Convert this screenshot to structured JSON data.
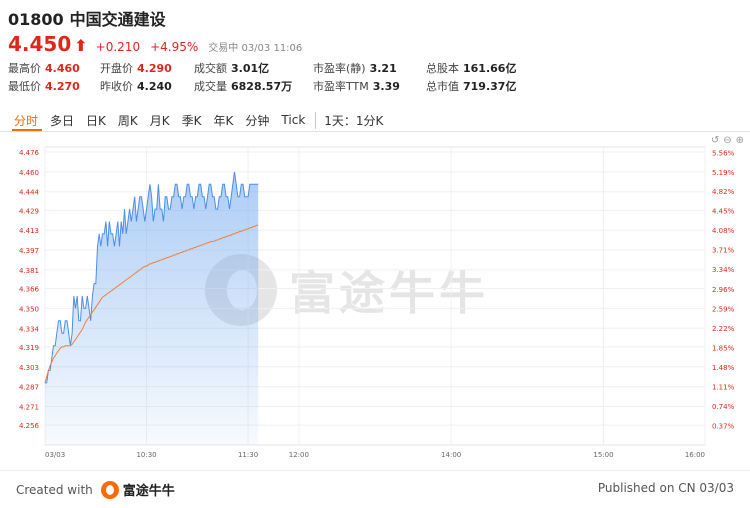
{
  "header": {
    "code": "01800",
    "name": "中国交通建设",
    "price": "4.450",
    "change": "+0.210",
    "change_pct": "+4.95%",
    "status": "交易中 03/03 11:06"
  },
  "stats": [
    {
      "label": "最高价",
      "value": "4.460",
      "red": true
    },
    {
      "label": "开盘价",
      "value": "4.290",
      "red": true
    },
    {
      "label": "成交额",
      "value": "3.01亿",
      "red": false
    },
    {
      "label": "市盈率(静)",
      "value": "3.21",
      "red": false
    },
    {
      "label": "总股本",
      "value": "161.66亿",
      "red": false
    },
    {
      "label": "最低价",
      "value": "4.270",
      "red": true
    },
    {
      "label": "昨收价",
      "value": "4.240",
      "red": false
    },
    {
      "label": "成交量",
      "value": "6828.57万",
      "red": false
    },
    {
      "label": "市盈率TTM",
      "value": "3.39",
      "red": false
    },
    {
      "label": "总市值",
      "value": "719.37亿",
      "red": false
    }
  ],
  "tabs": [
    "分时",
    "多日",
    "日K",
    "周K",
    "月K",
    "季K",
    "年K",
    "分钟",
    "Tick",
    "1天：1分K"
  ],
  "active_tab": 0,
  "tool_icons": [
    "undo-icon",
    "zoom-out-icon",
    "zoom-in-icon"
  ],
  "colors": {
    "up": "#e0261b",
    "accent": "#ff6a00",
    "price_line": "#4a8fe7",
    "avg_line": "#ef7f3f"
  },
  "watermark": "富途牛牛",
  "footer": {
    "created_with": "Created with",
    "brand": "富途牛牛",
    "published": "Published on CN 03/03"
  },
  "chart_data": {
    "type": "line",
    "prev_close": 4.24,
    "x_ticks": [
      "03/03",
      "10:30",
      "11:30",
      "12:00",
      "14:00",
      "15:00",
      "16:00"
    ],
    "y_ticks": [
      "4.476",
      "4.460",
      "4.444",
      "4.429",
      "4.413",
      "4.397",
      "4.381",
      "4.366",
      "4.350",
      "4.334",
      "4.319",
      "4.303",
      "4.287",
      "4.271",
      "4.256"
    ],
    "pct_ticks": [
      "5.56%",
      "5.19%",
      "4.82%",
      "4.45%",
      "4.08%",
      "3.71%",
      "3.34%",
      "2.96%",
      "2.59%",
      "2.22%",
      "1.85%",
      "1.48%",
      "1.11%",
      "0.74%",
      "0.37%"
    ],
    "ylim": [
      4.24,
      4.48
    ],
    "series": [
      {
        "values": [
          4.29,
          4.29,
          4.3,
          4.3,
          4.31,
          4.32,
          4.32,
          4.33,
          4.34,
          4.34,
          4.33,
          4.33,
          4.34,
          4.34,
          4.33,
          4.32,
          4.33,
          4.36,
          4.35,
          4.36,
          4.34,
          4.34,
          4.36,
          4.35,
          4.35,
          4.36,
          4.35,
          4.34,
          4.36,
          4.37,
          4.37,
          4.4,
          4.41,
          4.4,
          4.41,
          4.41,
          4.42,
          4.4,
          4.42,
          4.41,
          4.41,
          4.4,
          4.41,
          4.42,
          4.4,
          4.42,
          4.41,
          4.43,
          4.41,
          4.42,
          4.43,
          4.42,
          4.43,
          4.44,
          4.42,
          4.43,
          4.44,
          4.44,
          4.43,
          4.42,
          4.43,
          4.44,
          4.45,
          4.44,
          4.42,
          4.43,
          4.43,
          4.45,
          4.43,
          4.43,
          4.42,
          4.44,
          4.44,
          4.43,
          4.43,
          4.44,
          4.44,
          4.45,
          4.45,
          4.44,
          4.44,
          4.43,
          4.44,
          4.44,
          4.45,
          4.45,
          4.44,
          4.44,
          4.43,
          4.44,
          4.44,
          4.45,
          4.45,
          4.44,
          4.44,
          4.43,
          4.44,
          4.45,
          4.45,
          4.44,
          4.44,
          4.43,
          4.43,
          4.44,
          4.44,
          4.45,
          4.45,
          4.44,
          4.44,
          4.43,
          4.44,
          4.45,
          4.46,
          4.45,
          4.44,
          4.44,
          4.45,
          4.45,
          4.44,
          4.44,
          4.44,
          4.45,
          4.45,
          4.45,
          4.45,
          4.45,
          4.45
        ]
      },
      {
        "values": [
          4.29,
          4.295,
          4.3,
          4.304,
          4.307,
          4.31,
          4.312,
          4.314,
          4.316,
          4.318,
          4.319,
          4.319,
          4.32,
          4.32,
          4.32,
          4.32,
          4.321,
          4.323,
          4.325,
          4.327,
          4.329,
          4.331,
          4.333,
          4.336,
          4.339,
          4.341,
          4.343,
          4.345,
          4.347,
          4.349,
          4.351,
          4.353,
          4.355,
          4.357,
          4.359,
          4.36,
          4.361,
          4.362,
          4.363,
          4.364,
          4.365,
          4.366,
          4.367,
          4.368,
          4.369,
          4.37,
          4.371,
          4.372,
          4.373,
          4.374,
          4.375,
          4.376,
          4.377,
          4.378,
          4.379,
          4.38,
          4.381,
          4.382,
          4.383,
          4.384,
          4.384,
          4.385,
          4.386,
          4.386,
          4.387,
          4.387,
          4.388,
          4.388,
          4.389,
          4.389,
          4.39,
          4.39,
          4.391,
          4.391,
          4.392,
          4.392,
          4.393,
          4.393,
          4.394,
          4.394,
          4.395,
          4.395,
          4.396,
          4.396,
          4.397,
          4.397,
          4.398,
          4.398,
          4.399,
          4.399,
          4.4,
          4.4,
          4.401,
          4.401,
          4.402,
          4.402,
          4.403,
          4.403,
          4.404,
          4.404,
          4.404,
          4.405,
          4.405,
          4.406,
          4.406,
          4.407,
          4.407,
          4.408,
          4.408,
          4.409,
          4.409,
          4.41,
          4.41,
          4.411,
          4.411,
          4.412,
          4.412,
          4.413,
          4.413,
          4.414,
          4.414,
          4.415,
          4.415,
          4.416,
          4.416,
          4.417,
          4.417
        ]
      }
    ]
  }
}
